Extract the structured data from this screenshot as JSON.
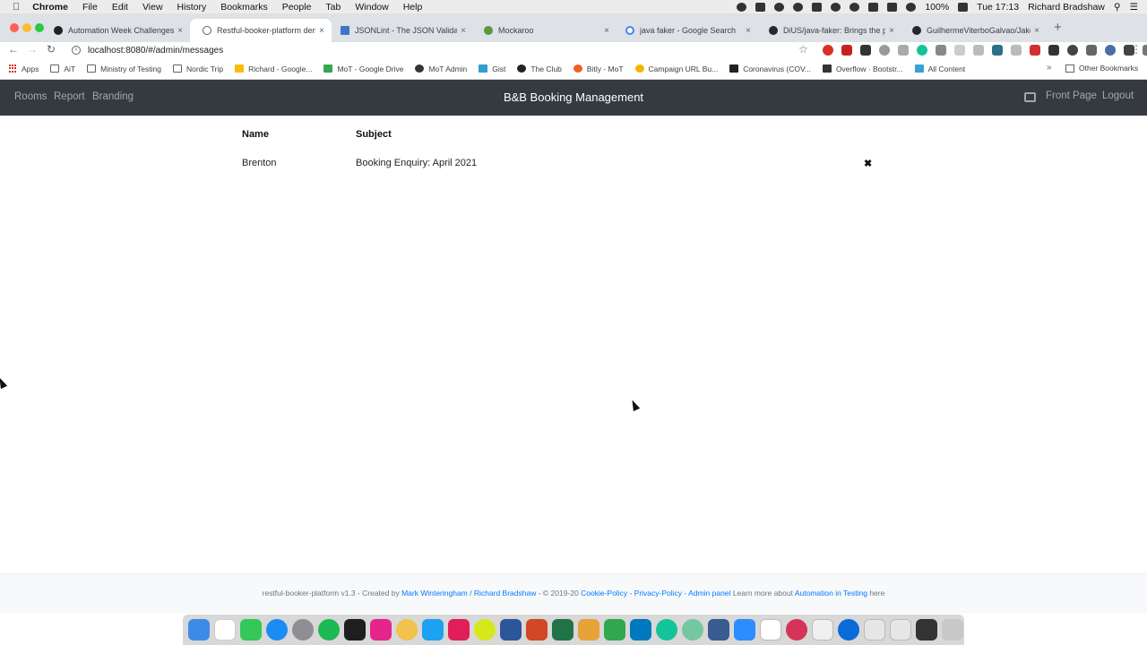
{
  "menubar": {
    "items": [
      "Chrome",
      "File",
      "Edit",
      "View",
      "History",
      "Bookmarks",
      "People",
      "Tab",
      "Window",
      "Help"
    ],
    "battery": "100%",
    "clock": "Tue 17:13",
    "user": "Richard Bradshaw"
  },
  "tabs": [
    {
      "title": "Automation Week Challenges"
    },
    {
      "title": "Restful-booker-platform demo"
    },
    {
      "title": "JSONLint - The JSON Validator"
    },
    {
      "title": "Mockaroo"
    },
    {
      "title": "java faker - Google Search"
    },
    {
      "title": "DiUS/java-faker: Brings the popular"
    },
    {
      "title": "GuilhermeViterboGalvao/Jaker"
    }
  ],
  "address_bar": {
    "url": "localhost:8080/#/admin/messages"
  },
  "bookmarks": [
    "Apps",
    "AiT",
    "Ministry of Testing",
    "Nordic Trip",
    "Richard - Google...",
    "MoT - Google Drive",
    "MoT Admin",
    "Gist",
    "The Club",
    "Bitly - MoT",
    "Campaign URL Bu...",
    "Coronavirus (COV...",
    "Overflow · Bootstr...",
    "All Content"
  ],
  "bookmarks_more": "»",
  "bookmarks_other": "Other Bookmarks",
  "app_nav": {
    "rooms": "Rooms",
    "report": "Report",
    "branding": "Branding",
    "brand": "B&B Booking Management",
    "front_page": "Front Page",
    "logout": "Logout"
  },
  "messages": {
    "headers": {
      "name": "Name",
      "subject": "Subject"
    },
    "rows": [
      {
        "name": "Brenton",
        "subject": "Booking Enquiry: April 2021"
      }
    ]
  },
  "footer": {
    "prefix": "restful-booker-platform v1.3 - Created by",
    "author1": "Mark Winteringham",
    "slash": "/",
    "author2": "Richard Bradshaw",
    "copyright": "- © 2019-20",
    "cookie": "Cookie-Policy",
    "dash1": "-",
    "privacy": "Privacy-Policy",
    "dash2": "-",
    "admin": "Admin panel",
    "learn": "Learn more about",
    "ait": "Automation in Testing",
    "here": "here"
  },
  "icons": {
    "back": "←",
    "forward": "→",
    "reload": "↻",
    "star": "☆",
    "close": "×",
    "delete": "✖",
    "new_tab": "+",
    "menu": "⋮"
  },
  "colors": {
    "navbar_bg": "#343a40",
    "link_blue": "#007bff",
    "footer_bg": "#f8f9fa"
  }
}
